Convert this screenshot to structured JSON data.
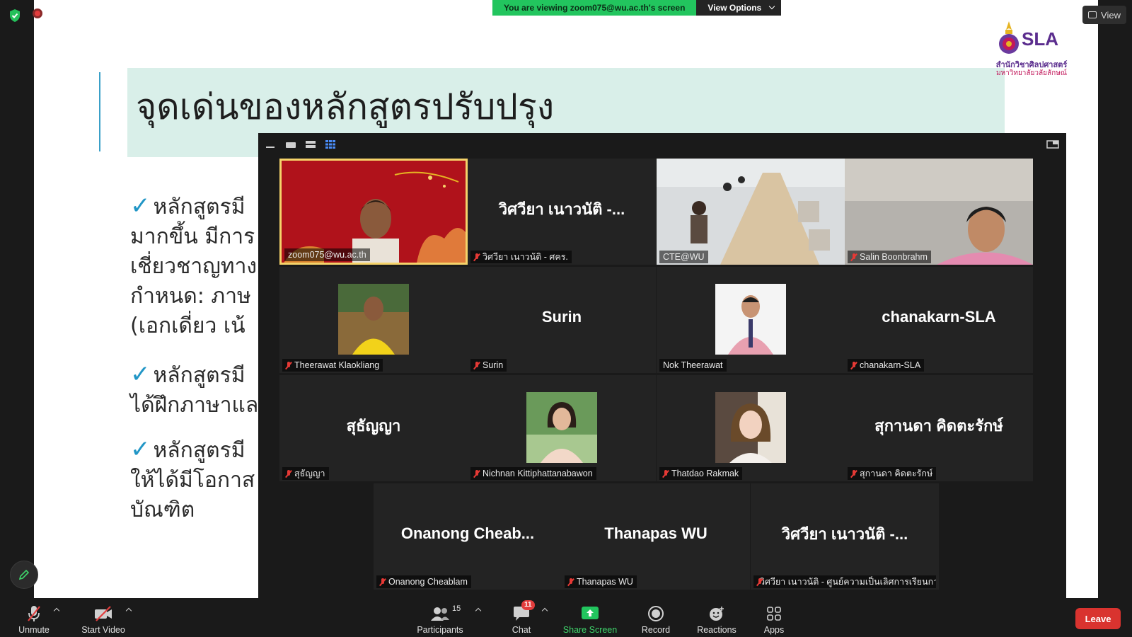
{
  "banner": {
    "message": "You are viewing zoom075@wu.ac.th's screen",
    "view_options": "View Options"
  },
  "top_right": {
    "view_label": "View"
  },
  "slide": {
    "title": "จุดเด่นของหลักสูตรปรับปรุง",
    "logo": {
      "name": "SLA",
      "line1": "สำนักวิชาศิลปศาสตร์",
      "line2": "มหาวิทยาลัยวลัยลักษณ์"
    },
    "bullet1": [
      "หลักสูตรมี",
      "มากขึ้น มีการ",
      "เชี่ยวชาญทาง",
      "กำหนด: ภาษ",
      "(เอกเดี่ยว เน้"
    ],
    "bullet2": [
      "หลักสูตรมี",
      "ได้ฝึกภาษาแล"
    ],
    "bullet3": [
      "หลักสูตรมี",
      "ให้ได้มีโอกาส",
      "บัณฑิต"
    ]
  },
  "participants": [
    {
      "label": "zoom075@wu.ac.th",
      "big": "",
      "video": "red-background",
      "muted": false,
      "active": true
    },
    {
      "label": "วิศวียา เนาวนัติ - ศคร.",
      "big": "วิศวียา เนาวนัติ -...",
      "video": "",
      "muted": true
    },
    {
      "label": "CTE@WU",
      "big": "",
      "video": "meeting-room",
      "muted": false
    },
    {
      "label": "Salin Boonbrahm",
      "big": "",
      "video": "person",
      "muted": true
    },
    {
      "label": "Theerawat Klaokliang",
      "big": "",
      "video": "yellow-shirt",
      "muted": true
    },
    {
      "label": "Surin",
      "big": "Surin",
      "video": "",
      "muted": true
    },
    {
      "label": "Nok Theerawat",
      "big": "",
      "video": "pink-shirt",
      "muted": false
    },
    {
      "label": "chanakarn-SLA",
      "big": "chanakarn-SLA",
      "video": "",
      "muted": true
    },
    {
      "label": "สุธัญญา",
      "big": "สุธัญญา",
      "video": "",
      "muted": true
    },
    {
      "label": "Nichnan Kittiphattanabawon",
      "big": "",
      "video": "woman-portrait",
      "muted": true
    },
    {
      "label": "Thatdao Rakmak",
      "big": "",
      "video": "woman-portrait-2",
      "muted": true
    },
    {
      "label": "สุกานดา คิดตะรักษ์",
      "big": "สุกานดา คิดตะรักษ์",
      "video": "",
      "muted": true
    },
    {
      "label": "Onanong Cheablam",
      "big": "Onanong  Cheab...",
      "video": "",
      "muted": true
    },
    {
      "label": "Thanapas WU",
      "big": "Thanapas WU",
      "video": "",
      "muted": true
    },
    {
      "label": "วิศวียา เนาวนัติ - ศูนย์ความเป็นเลิศการเรียนกา...",
      "big": "วิศวียา เนาวนัติ -...",
      "video": "",
      "muted": true
    }
  ],
  "toolbar": {
    "unmute": "Unmute",
    "start_video": "Start Video",
    "participants": "Participants",
    "participants_count": "15",
    "chat": "Chat",
    "chat_badge": "11",
    "share_screen": "Share Screen",
    "record": "Record",
    "reactions": "Reactions",
    "apps": "Apps",
    "leave": "Leave"
  },
  "colors": {
    "share_green": "#22c55e",
    "leave_red": "#d9332f",
    "active_border": "#f5d36a",
    "slide_title_bg": "#d9efe9",
    "check_blue": "#2196c6",
    "brand_purple": "#5b2d8e"
  }
}
